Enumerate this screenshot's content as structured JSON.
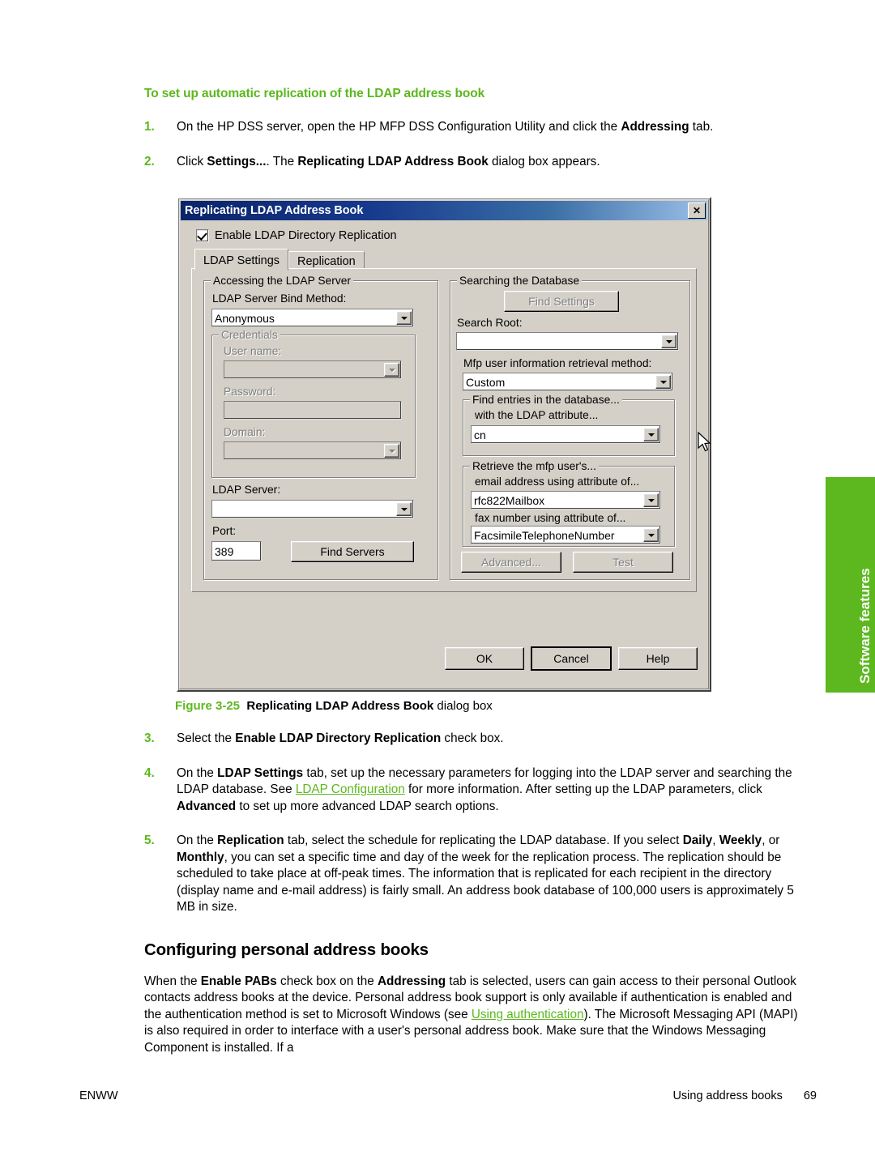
{
  "heading": "To set up automatic replication of the LDAP address book",
  "steps": [
    {
      "num": "1.",
      "parts": [
        {
          "t": "On the HP DSS server, open the HP MFP DSS Configuration Utility and click the ",
          "s": "n"
        },
        {
          "t": "Addressing",
          "s": "b"
        },
        {
          "t": " tab.",
          "s": "n"
        }
      ]
    },
    {
      "num": "2.",
      "parts": [
        {
          "t": "Click ",
          "s": "n"
        },
        {
          "t": "Settings...",
          "s": "b"
        },
        {
          "t": ". The ",
          "s": "n"
        },
        {
          "t": "Replicating LDAP Address Book",
          "s": "b"
        },
        {
          "t": " dialog box appears.",
          "s": "n"
        }
      ]
    },
    {
      "num": "3.",
      "parts": [
        {
          "t": "Select the ",
          "s": "n"
        },
        {
          "t": "Enable LDAP Directory Replication",
          "s": "b"
        },
        {
          "t": " check box.",
          "s": "n"
        }
      ]
    },
    {
      "num": "4.",
      "parts": [
        {
          "t": "On the ",
          "s": "n"
        },
        {
          "t": "LDAP Settings",
          "s": "b"
        },
        {
          "t": " tab, set up the necessary parameters for logging into the LDAP server and searching the LDAP database. See ",
          "s": "n"
        },
        {
          "t": "LDAP Configuration",
          "s": "link"
        },
        {
          "t": " for more information. After setting up the LDAP parameters, click ",
          "s": "n"
        },
        {
          "t": "Advanced",
          "s": "b"
        },
        {
          "t": " to set up more advanced LDAP search options.",
          "s": "n"
        }
      ]
    },
    {
      "num": "5.",
      "parts": [
        {
          "t": "On the ",
          "s": "n"
        },
        {
          "t": "Replication",
          "s": "b"
        },
        {
          "t": " tab, select the schedule for replicating the LDAP database. If you select ",
          "s": "n"
        },
        {
          "t": "Daily",
          "s": "b"
        },
        {
          "t": ", ",
          "s": "n"
        },
        {
          "t": "Weekly",
          "s": "b"
        },
        {
          "t": ", or ",
          "s": "n"
        },
        {
          "t": "Monthly",
          "s": "b"
        },
        {
          "t": ", you can set a specific time and day of the week for the replication process. The replication should be scheduled to take place at off-peak times. The information that is replicated for each recipient in the directory (display name and e-mail address) is fairly small. An address book database of 100,000 users is approximately 5 MB in size.",
          "s": "n"
        }
      ]
    }
  ],
  "figure_caption": {
    "number": "Figure 3-25",
    "bold_title": "Replicating LDAP Address Book",
    "suffix": " dialog box"
  },
  "section": {
    "title": "Configuring personal address books",
    "paragraph_parts": [
      {
        "t": "When the ",
        "s": "n"
      },
      {
        "t": "Enable PABs",
        "s": "b"
      },
      {
        "t": " check box on the ",
        "s": "n"
      },
      {
        "t": "Addressing",
        "s": "b"
      },
      {
        "t": " tab is selected, users can gain access to their personal Outlook contacts address books at the device. Personal address book support is only available if authentication is enabled and the authentication method is set to Microsoft Windows (see ",
        "s": "n"
      },
      {
        "t": "Using authentication",
        "s": "link"
      },
      {
        "t": "). The Microsoft Messaging API (MAPI) is also required in order to interface with a user's personal address book. Make sure that the Windows Messaging Component is installed. If a",
        "s": "n"
      }
    ]
  },
  "side_tab": {
    "label": "Software features",
    "color": "#5CB81E"
  },
  "footer": {
    "left": "ENWW",
    "section": "Using address books",
    "page": "69"
  },
  "dialog": {
    "title": "Replicating LDAP Address Book",
    "close_label": "✕",
    "enable_checkbox": {
      "label": "Enable LDAP Directory Replication",
      "checked": true
    },
    "tabs": [
      {
        "label": "LDAP Settings",
        "active": true
      },
      {
        "label": "Replication",
        "active": false
      }
    ],
    "left_group": {
      "legend": "Accessing the LDAP Server",
      "bind_method_label": "LDAP Server Bind Method:",
      "bind_method_value": "Anonymous",
      "credentials": {
        "legend": "Credentials",
        "username_label": "User name:",
        "username_value": "",
        "password_label": "Password:",
        "password_value": "",
        "domain_label": "Domain:",
        "domain_value": ""
      },
      "ldap_server_label": "LDAP Server:",
      "ldap_server_value": "",
      "port_label": "Port:",
      "port_value": "389",
      "find_servers_button": "Find Servers"
    },
    "right_group": {
      "legend": "Searching the Database",
      "find_settings_button": "Find Settings",
      "search_root_label": "Search Root:",
      "search_root_value": "",
      "retrieval_label": "Mfp user information retrieval method:",
      "retrieval_value": "Custom",
      "find_entries": {
        "legend": "Find entries in the database...",
        "attribute_label": "with the LDAP attribute...",
        "attribute_value": "cn"
      },
      "retrieve_user": {
        "legend": "Retrieve the mfp user's...",
        "email_label": "email address using attribute of...",
        "email_value": "rfc822Mailbox",
        "fax_label": "fax number using attribute of...",
        "fax_value": "FacsimileTelephoneNumber"
      },
      "advanced_button": "Advanced...",
      "test_button": "Test"
    },
    "footer_buttons": [
      {
        "label": "OK",
        "default": false
      },
      {
        "label": "Cancel",
        "default": true
      },
      {
        "label": "Help",
        "default": false
      }
    ]
  }
}
